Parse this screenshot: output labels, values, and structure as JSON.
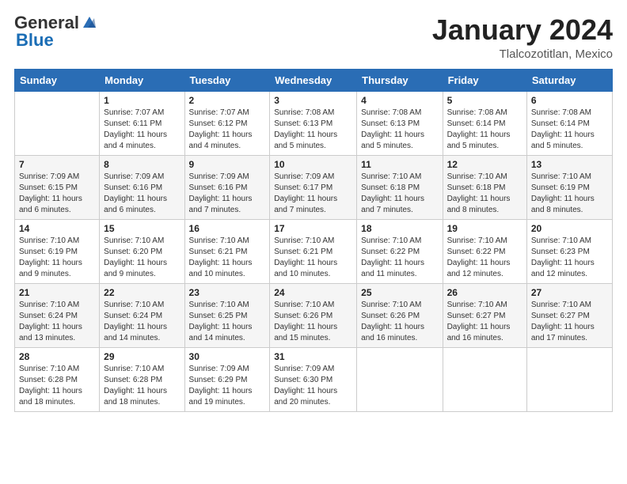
{
  "header": {
    "logo_general": "General",
    "logo_blue": "Blue",
    "month": "January 2024",
    "location": "Tlalcozotitlan, Mexico"
  },
  "days_of_week": [
    "Sunday",
    "Monday",
    "Tuesday",
    "Wednesday",
    "Thursday",
    "Friday",
    "Saturday"
  ],
  "weeks": [
    [
      {
        "day": "",
        "detail": ""
      },
      {
        "day": "1",
        "detail": "Sunrise: 7:07 AM\nSunset: 6:11 PM\nDaylight: 11 hours\nand 4 minutes."
      },
      {
        "day": "2",
        "detail": "Sunrise: 7:07 AM\nSunset: 6:12 PM\nDaylight: 11 hours\nand 4 minutes."
      },
      {
        "day": "3",
        "detail": "Sunrise: 7:08 AM\nSunset: 6:13 PM\nDaylight: 11 hours\nand 5 minutes."
      },
      {
        "day": "4",
        "detail": "Sunrise: 7:08 AM\nSunset: 6:13 PM\nDaylight: 11 hours\nand 5 minutes."
      },
      {
        "day": "5",
        "detail": "Sunrise: 7:08 AM\nSunset: 6:14 PM\nDaylight: 11 hours\nand 5 minutes."
      },
      {
        "day": "6",
        "detail": "Sunrise: 7:08 AM\nSunset: 6:14 PM\nDaylight: 11 hours\nand 5 minutes."
      }
    ],
    [
      {
        "day": "7",
        "detail": "Sunrise: 7:09 AM\nSunset: 6:15 PM\nDaylight: 11 hours\nand 6 minutes."
      },
      {
        "day": "8",
        "detail": "Sunrise: 7:09 AM\nSunset: 6:16 PM\nDaylight: 11 hours\nand 6 minutes."
      },
      {
        "day": "9",
        "detail": "Sunrise: 7:09 AM\nSunset: 6:16 PM\nDaylight: 11 hours\nand 7 minutes."
      },
      {
        "day": "10",
        "detail": "Sunrise: 7:09 AM\nSunset: 6:17 PM\nDaylight: 11 hours\nand 7 minutes."
      },
      {
        "day": "11",
        "detail": "Sunrise: 7:10 AM\nSunset: 6:18 PM\nDaylight: 11 hours\nand 7 minutes."
      },
      {
        "day": "12",
        "detail": "Sunrise: 7:10 AM\nSunset: 6:18 PM\nDaylight: 11 hours\nand 8 minutes."
      },
      {
        "day": "13",
        "detail": "Sunrise: 7:10 AM\nSunset: 6:19 PM\nDaylight: 11 hours\nand 8 minutes."
      }
    ],
    [
      {
        "day": "14",
        "detail": "Sunrise: 7:10 AM\nSunset: 6:19 PM\nDaylight: 11 hours\nand 9 minutes."
      },
      {
        "day": "15",
        "detail": "Sunrise: 7:10 AM\nSunset: 6:20 PM\nDaylight: 11 hours\nand 9 minutes."
      },
      {
        "day": "16",
        "detail": "Sunrise: 7:10 AM\nSunset: 6:21 PM\nDaylight: 11 hours\nand 10 minutes."
      },
      {
        "day": "17",
        "detail": "Sunrise: 7:10 AM\nSunset: 6:21 PM\nDaylight: 11 hours\nand 10 minutes."
      },
      {
        "day": "18",
        "detail": "Sunrise: 7:10 AM\nSunset: 6:22 PM\nDaylight: 11 hours\nand 11 minutes."
      },
      {
        "day": "19",
        "detail": "Sunrise: 7:10 AM\nSunset: 6:22 PM\nDaylight: 11 hours\nand 12 minutes."
      },
      {
        "day": "20",
        "detail": "Sunrise: 7:10 AM\nSunset: 6:23 PM\nDaylight: 11 hours\nand 12 minutes."
      }
    ],
    [
      {
        "day": "21",
        "detail": "Sunrise: 7:10 AM\nSunset: 6:24 PM\nDaylight: 11 hours\nand 13 minutes."
      },
      {
        "day": "22",
        "detail": "Sunrise: 7:10 AM\nSunset: 6:24 PM\nDaylight: 11 hours\nand 14 minutes."
      },
      {
        "day": "23",
        "detail": "Sunrise: 7:10 AM\nSunset: 6:25 PM\nDaylight: 11 hours\nand 14 minutes."
      },
      {
        "day": "24",
        "detail": "Sunrise: 7:10 AM\nSunset: 6:26 PM\nDaylight: 11 hours\nand 15 minutes."
      },
      {
        "day": "25",
        "detail": "Sunrise: 7:10 AM\nSunset: 6:26 PM\nDaylight: 11 hours\nand 16 minutes."
      },
      {
        "day": "26",
        "detail": "Sunrise: 7:10 AM\nSunset: 6:27 PM\nDaylight: 11 hours\nand 16 minutes."
      },
      {
        "day": "27",
        "detail": "Sunrise: 7:10 AM\nSunset: 6:27 PM\nDaylight: 11 hours\nand 17 minutes."
      }
    ],
    [
      {
        "day": "28",
        "detail": "Sunrise: 7:10 AM\nSunset: 6:28 PM\nDaylight: 11 hours\nand 18 minutes."
      },
      {
        "day": "29",
        "detail": "Sunrise: 7:10 AM\nSunset: 6:28 PM\nDaylight: 11 hours\nand 18 minutes."
      },
      {
        "day": "30",
        "detail": "Sunrise: 7:09 AM\nSunset: 6:29 PM\nDaylight: 11 hours\nand 19 minutes."
      },
      {
        "day": "31",
        "detail": "Sunrise: 7:09 AM\nSunset: 6:30 PM\nDaylight: 11 hours\nand 20 minutes."
      },
      {
        "day": "",
        "detail": ""
      },
      {
        "day": "",
        "detail": ""
      },
      {
        "day": "",
        "detail": ""
      }
    ]
  ]
}
